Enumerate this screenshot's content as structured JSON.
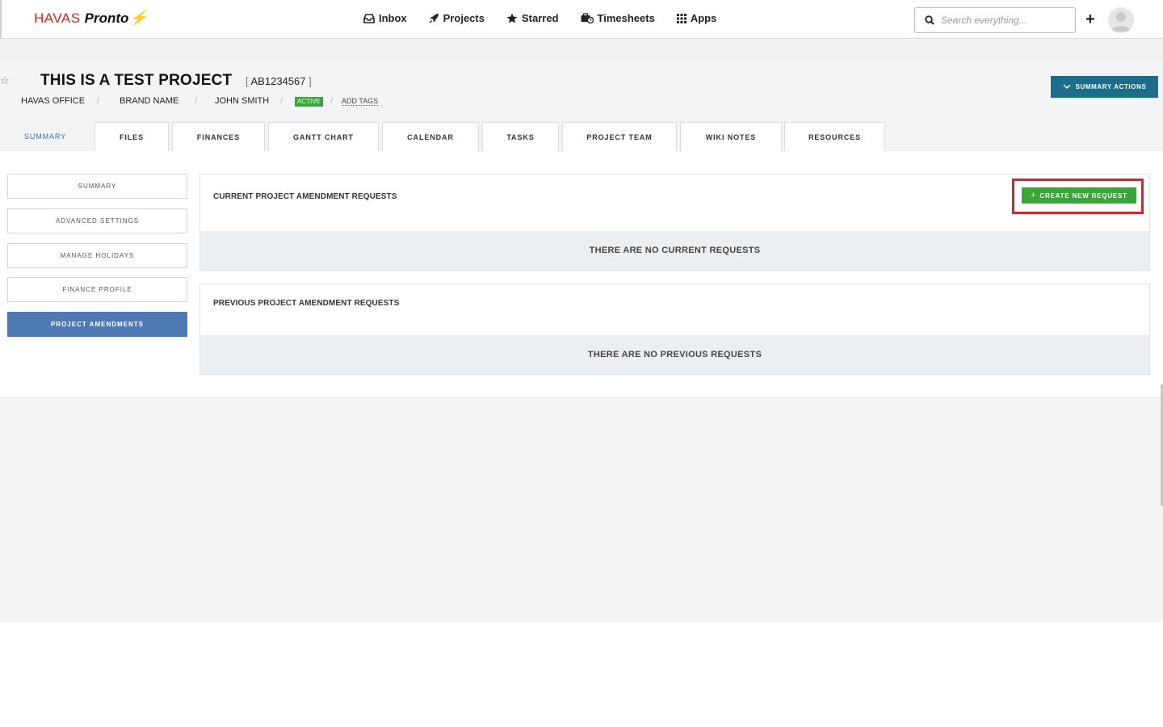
{
  "brand": {
    "part1": "HAVAS",
    "part2": "Pronto",
    "bolt": "⚡"
  },
  "nav": {
    "items": [
      {
        "label": "Inbox",
        "icon": "inbox-icon"
      },
      {
        "label": "Projects",
        "icon": "rocket-icon"
      },
      {
        "label": "Starred",
        "icon": "star-icon"
      },
      {
        "label": "Timesheets",
        "icon": "briefcase-clock-icon"
      },
      {
        "label": "Apps",
        "icon": "grid-icon"
      }
    ]
  },
  "search": {
    "placeholder": "Search everything..."
  },
  "add_label": "+",
  "project": {
    "title": "THIS IS A TEST PROJECT",
    "code": "AB1234567",
    "office": "HAVAS OFFICE",
    "brand": "BRAND NAME",
    "owner": "JOHN SMITH",
    "status": "ACTIVE",
    "add_tags": "ADD TAGS",
    "separator": "/"
  },
  "summary_actions_label": "SUMMARY ACTIONS",
  "tabs": [
    {
      "label": "SUMMARY"
    },
    {
      "label": "FILES"
    },
    {
      "label": "FINANCES"
    },
    {
      "label": "GANTT CHART"
    },
    {
      "label": "CALENDAR"
    },
    {
      "label": "TASKS"
    },
    {
      "label": "PROJECT TEAM"
    },
    {
      "label": "WIKI NOTES"
    },
    {
      "label": "RESOURCES"
    }
  ],
  "side_menu": [
    {
      "label": "SUMMARY"
    },
    {
      "label": "ADVANCED SETTINGS"
    },
    {
      "label": "MANAGE HOLIDAYS"
    },
    {
      "label": "FINANCE PROFILE"
    },
    {
      "label": "PROJECT AMENDMENTS"
    }
  ],
  "current_requests": {
    "title": "CURRENT PROJECT AMENDMENT REQUESTS",
    "create_label": "CREATE NEW REQUEST",
    "empty": "THERE ARE NO CURRENT REQUESTS"
  },
  "previous_requests": {
    "title": "PREVIOUS PROJECT AMENDMENT REQUESTS",
    "empty": "THERE ARE NO PREVIOUS REQUESTS"
  },
  "colors": {
    "brand_red": "#e2231a",
    "accent_blue": "#1b6d8a",
    "active_side": "#4f79b3",
    "create_green": "#3aa63a",
    "highlight_red": "#d6232a"
  }
}
